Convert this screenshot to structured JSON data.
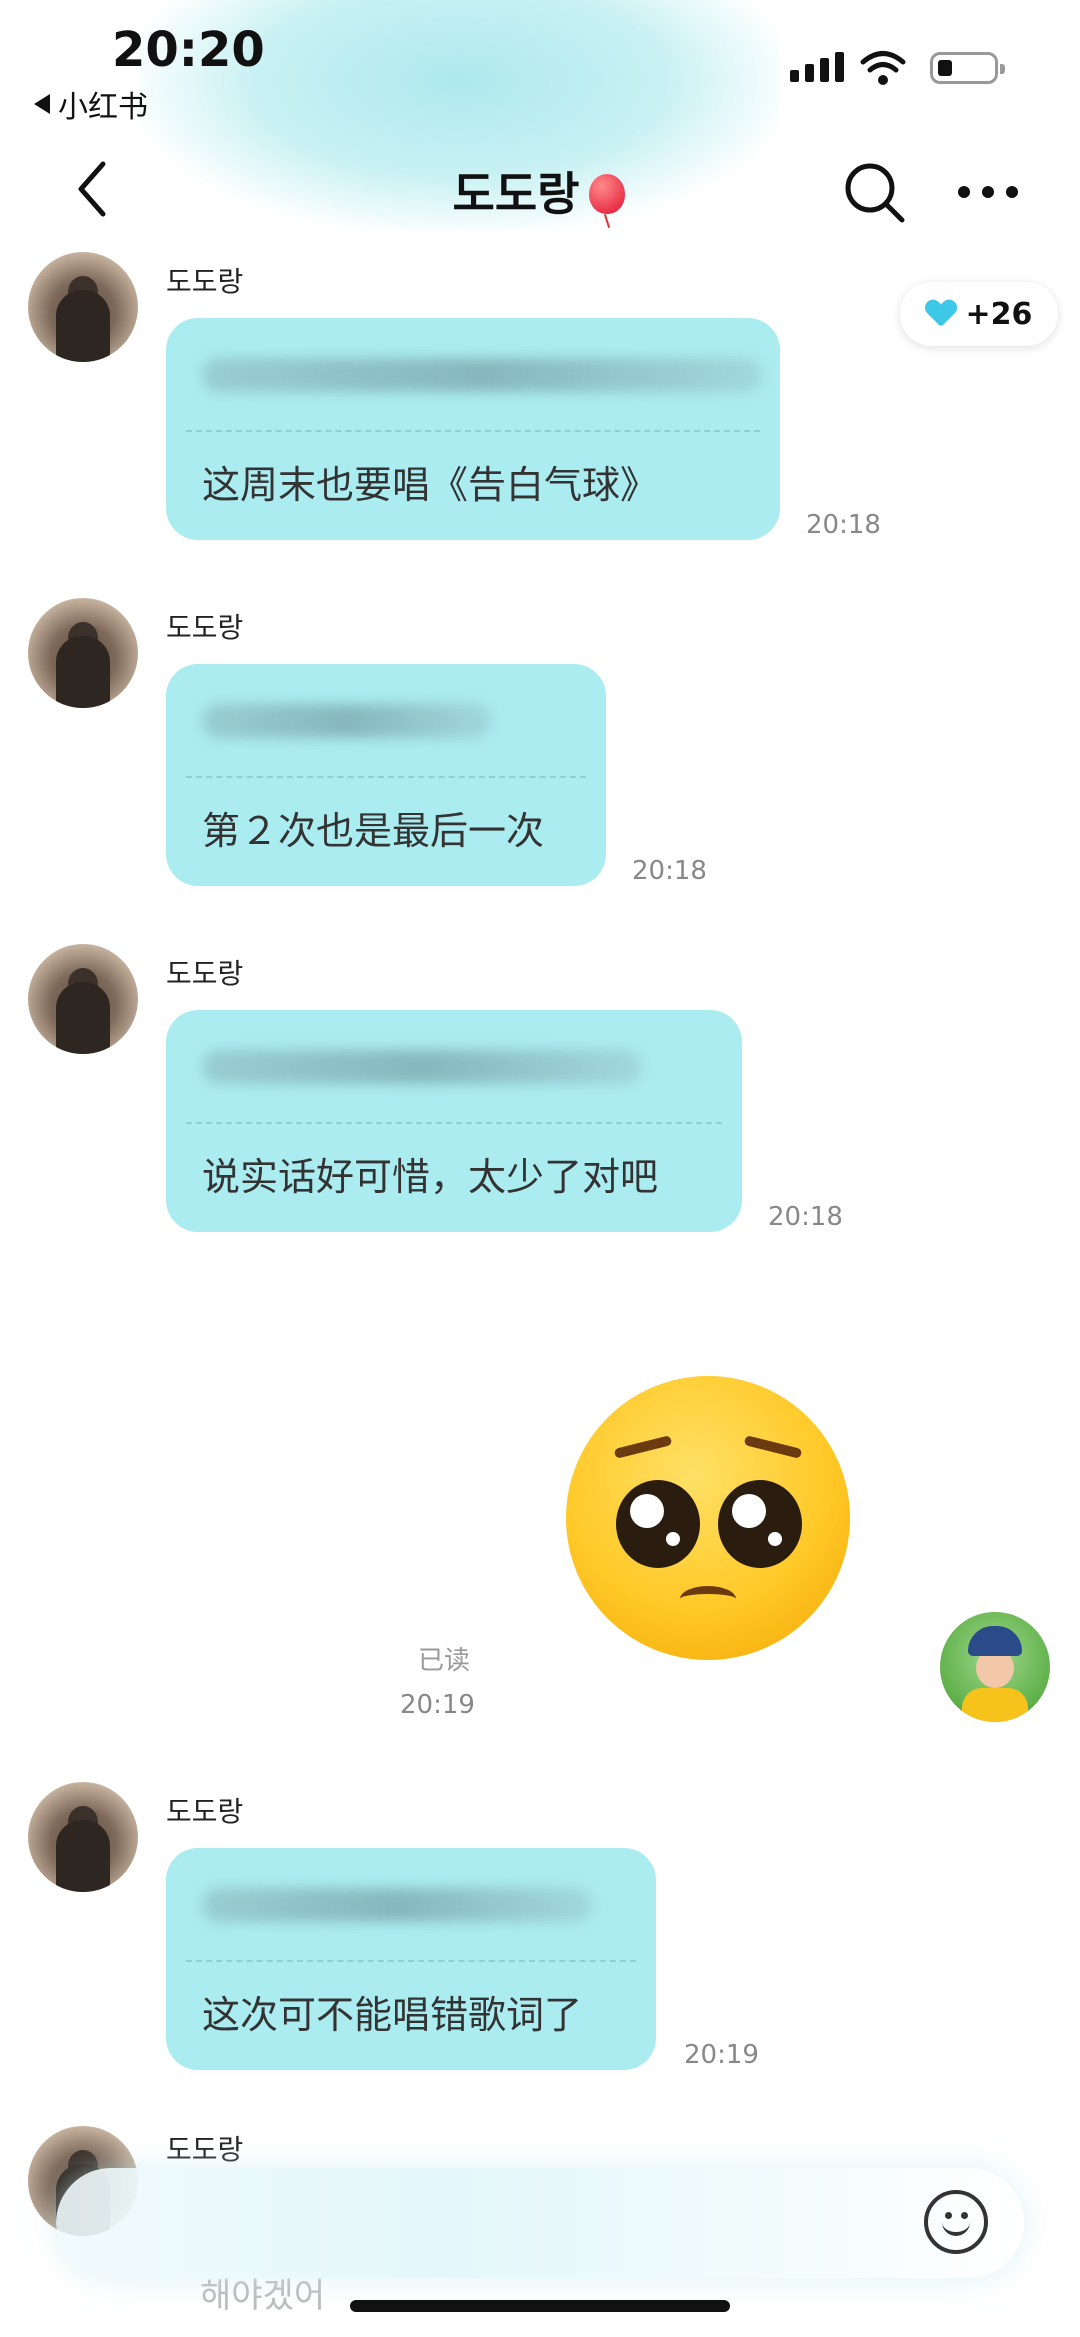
{
  "status_bar": {
    "time": "20:20",
    "back_app": "小红书"
  },
  "header": {
    "title": "도도랑",
    "title_emoji": "balloon"
  },
  "like_badge": {
    "count": "+26",
    "icon": "heart-icon",
    "color": "#3cc8e6"
  },
  "messages": [
    {
      "sender": "도도랑",
      "translation": "这周末也要唱《告白气球》",
      "time": "20:18"
    },
    {
      "sender": "도도랑",
      "translation": "第２次也是最后一次",
      "time": "20:18"
    },
    {
      "sender": "도도랑",
      "translation": "说实话好可惜，太少了对吧",
      "time": "20:18"
    },
    {
      "sender": "도도랑",
      "translation": "这次可不能唱错歌词了",
      "time": "20:19"
    },
    {
      "sender": "도도랑",
      "partial_text": "해야겠어"
    }
  ],
  "my_message": {
    "content": "pleading-face-emoji",
    "read_status": "已读",
    "time": "20:19"
  },
  "colors": {
    "bubble": "#aaecf0",
    "accent": "#3cc8e6"
  }
}
